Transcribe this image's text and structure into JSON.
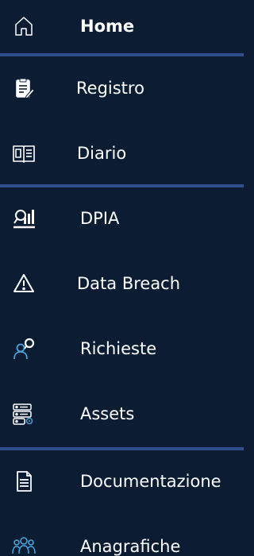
{
  "sidebar": {
    "items": [
      {
        "label": "Home",
        "icon": "home-icon",
        "active": true
      },
      {
        "label": "Registro",
        "icon": "register-icon"
      },
      {
        "label": "Diario",
        "icon": "diary-icon"
      },
      {
        "label": "DPIA",
        "icon": "dpia-icon"
      },
      {
        "label": "Data Breach",
        "icon": "warning-icon"
      },
      {
        "label": "Richieste",
        "icon": "requests-icon"
      },
      {
        "label": "Assets",
        "icon": "assets-icon"
      },
      {
        "label": "Documentazione",
        "icon": "document-icon"
      },
      {
        "label": "Anagrafiche",
        "icon": "people-icon"
      }
    ]
  },
  "colors": {
    "background": "#0c1c33",
    "divider": "#2e4f8e",
    "text": "#ffffff"
  }
}
